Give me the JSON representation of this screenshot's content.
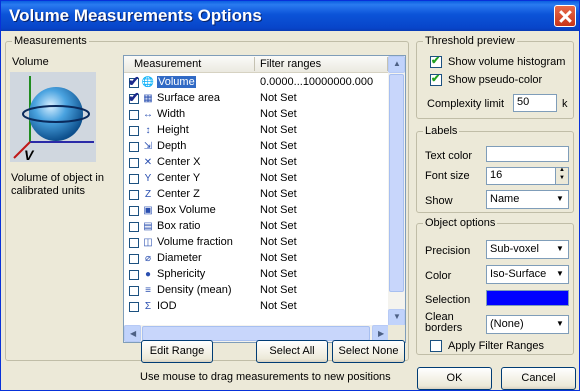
{
  "window": {
    "title": "Volume Measurements Options"
  },
  "measurements": {
    "legend": "Measurements",
    "subtitle": "Volume",
    "description": "Volume of object in calibrated units",
    "columns": [
      "Measurement",
      "Filter ranges"
    ],
    "rows": [
      {
        "name": "Volume",
        "range": "0.0000...10000000.000",
        "checked": true,
        "selected": true,
        "icon": "volume-icon"
      },
      {
        "name": "Surface area",
        "range": "Not Set",
        "checked": true,
        "selected": false,
        "icon": "surface-area-icon"
      },
      {
        "name": "Width",
        "range": "Not Set",
        "checked": false,
        "selected": false,
        "icon": "width-icon"
      },
      {
        "name": "Height",
        "range": "Not Set",
        "checked": false,
        "selected": false,
        "icon": "height-icon"
      },
      {
        "name": "Depth",
        "range": "Not Set",
        "checked": false,
        "selected": false,
        "icon": "depth-icon"
      },
      {
        "name": "Center X",
        "range": "Not Set",
        "checked": false,
        "selected": false,
        "icon": "center-x-icon"
      },
      {
        "name": "Center Y",
        "range": "Not Set",
        "checked": false,
        "selected": false,
        "icon": "center-y-icon"
      },
      {
        "name": "Center Z",
        "range": "Not Set",
        "checked": false,
        "selected": false,
        "icon": "center-z-icon"
      },
      {
        "name": "Box Volume",
        "range": "Not Set",
        "checked": false,
        "selected": false,
        "icon": "box-volume-icon"
      },
      {
        "name": "Box ratio",
        "range": "Not Set",
        "checked": false,
        "selected": false,
        "icon": "box-ratio-icon"
      },
      {
        "name": "Volume fraction",
        "range": "Not Set",
        "checked": false,
        "selected": false,
        "icon": "volume-fraction-icon"
      },
      {
        "name": "Diameter",
        "range": "Not Set",
        "checked": false,
        "selected": false,
        "icon": "diameter-icon"
      },
      {
        "name": "Sphericity",
        "range": "Not Set",
        "checked": false,
        "selected": false,
        "icon": "sphericity-icon"
      },
      {
        "name": "Density (mean)",
        "range": "Not Set",
        "checked": false,
        "selected": false,
        "icon": "density-icon"
      },
      {
        "name": "IOD",
        "range": "Not Set",
        "checked": false,
        "selected": false,
        "icon": "iod-icon"
      }
    ],
    "buttons": {
      "edit_range": "Edit Range",
      "select_all": "Select All",
      "select_none": "Select None"
    },
    "hint": "Use mouse to drag measurements to new positions",
    "preview_axis_label": "V"
  },
  "threshold": {
    "legend": "Threshold preview",
    "show_histogram": {
      "label": "Show volume histogram",
      "checked": true
    },
    "show_pseudo": {
      "label": "Show pseudo-color",
      "checked": true
    },
    "complexity_label": "Complexity limit",
    "complexity_value": "50",
    "complexity_unit": "k"
  },
  "labels": {
    "legend": "Labels",
    "text_color_label": "Text color",
    "text_color": "#ffffff",
    "font_size_label": "Font size",
    "font_size_value": "16",
    "show_label": "Show",
    "show_value": "Name"
  },
  "object_options": {
    "legend": "Object options",
    "precision_label": "Precision",
    "precision_value": "Sub-voxel",
    "color_label": "Color",
    "color_value": "Iso-Surface",
    "selection_label": "Selection",
    "selection_color": "#0000ff",
    "clean_borders_label": "Clean borders",
    "clean_borders_value": "(None)",
    "apply_filter": {
      "label": "Apply Filter Ranges",
      "checked": false
    }
  },
  "footer": {
    "ok": "OK",
    "cancel": "Cancel"
  }
}
